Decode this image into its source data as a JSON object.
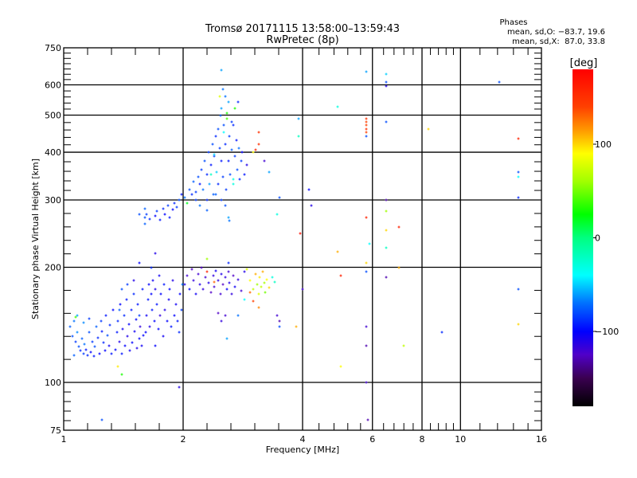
{
  "chart_data": {
    "type": "scatter",
    "title": "Tromsø 20171115 13:58:00–13:59:43",
    "subtitle": "RwPretec (8p)",
    "stats": {
      "heading": "Phases",
      "o_line": "mean, sd,O: −83.7, 19.6",
      "x_line": "mean, sd,X:  87.0, 33.8"
    },
    "xlabel": "Frequency [MHz]",
    "ylabel": "Stationary phase Virtual Height [km]",
    "xscale": "log",
    "yscale": "log",
    "xlim": [
      1,
      16
    ],
    "ylim": [
      75,
      750
    ],
    "xticks": [
      1,
      2,
      4,
      6,
      8,
      10,
      16
    ],
    "xtick_labels": [
      "1",
      "2",
      "4",
      "6",
      "8",
      "10",
      "16"
    ],
    "yticks": [
      75,
      100,
      200,
      300,
      400,
      500,
      600,
      750
    ],
    "ytick_labels": [
      "75",
      "100",
      "200",
      "300",
      "400",
      "500",
      "600",
      "750"
    ],
    "grid": true,
    "colorbar": {
      "label": "[deg]",
      "range": [
        -180,
        180
      ],
      "ticks": [
        100,
        0,
        -100
      ],
      "tick_labels": [
        "100",
        "0",
        "−100"
      ],
      "stops": [
        [
          -180,
          "#000000"
        ],
        [
          -150,
          "#3a0050"
        ],
        [
          -125,
          "#5000c8"
        ],
        [
          -100,
          "#0000ff"
        ],
        [
          -70,
          "#0070ff"
        ],
        [
          -40,
          "#00ffff"
        ],
        [
          0,
          "#00ff80"
        ],
        [
          25,
          "#00ff00"
        ],
        [
          60,
          "#a0ff00"
        ],
        [
          90,
          "#ffff00"
        ],
        [
          115,
          "#ff9900"
        ],
        [
          140,
          "#ff4000"
        ],
        [
          180,
          "#ff0000"
        ]
      ]
    },
    "point_fields": [
      "frequency_mhz",
      "height_km",
      "phase_deg"
    ],
    "points": [
      [
        1.04,
        140,
        -75
      ],
      [
        1.05,
        132,
        -80
      ],
      [
        1.06,
        145,
        -70
      ],
      [
        1.07,
        128,
        -85
      ],
      [
        1.08,
        135,
        -65
      ],
      [
        1.09,
        124,
        -80
      ],
      [
        1.1,
        121,
        -90
      ],
      [
        1.11,
        130,
        -75
      ],
      [
        1.12,
        119,
        -85
      ],
      [
        1.13,
        126,
        -70
      ],
      [
        1.14,
        122,
        -95
      ],
      [
        1.15,
        118,
        -90
      ],
      [
        1.16,
        135,
        -80
      ],
      [
        1.17,
        120,
        -100
      ],
      [
        1.18,
        128,
        -85
      ],
      [
        1.19,
        117,
        -95
      ],
      [
        1.2,
        124,
        -80
      ],
      [
        1.21,
        140,
        -75
      ],
      [
        1.22,
        131,
        -90
      ],
      [
        1.23,
        119,
        -100
      ],
      [
        1.24,
        145,
        -85
      ],
      [
        1.25,
        136,
        -95
      ],
      [
        1.26,
        127,
        -90
      ],
      [
        1.27,
        121,
        -100
      ],
      [
        1.28,
        150,
        -95
      ],
      [
        1.29,
        133,
        -80
      ],
      [
        1.3,
        125,
        -105
      ],
      [
        1.31,
        141,
        -90
      ],
      [
        1.32,
        119,
        -95
      ],
      [
        1.33,
        155,
        -100
      ],
      [
        1.08,
        150,
        -60
      ],
      [
        1.12,
        143,
        -65
      ],
      [
        1.06,
        118,
        -75
      ],
      [
        1.16,
        147,
        -85
      ],
      [
        1.37,
        110,
        95
      ],
      [
        1.07,
        148,
        40
      ],
      [
        1.35,
        122,
        -100
      ],
      [
        1.36,
        135,
        -95
      ],
      [
        1.37,
        145,
        -90
      ],
      [
        1.38,
        128,
        -110
      ],
      [
        1.39,
        160,
        -100
      ],
      [
        1.4,
        119,
        -95
      ],
      [
        1.41,
        138,
        -105
      ],
      [
        1.42,
        150,
        -90
      ],
      [
        1.43,
        125,
        -100
      ],
      [
        1.44,
        165,
        -95
      ],
      [
        1.45,
        132,
        -110
      ],
      [
        1.46,
        142,
        -100
      ],
      [
        1.47,
        121,
        -105
      ],
      [
        1.48,
        155,
        -95
      ],
      [
        1.49,
        127,
        -100
      ],
      [
        1.5,
        170,
        -90
      ],
      [
        1.51,
        136,
        -105
      ],
      [
        1.52,
        146,
        -100
      ],
      [
        1.53,
        123,
        -110
      ],
      [
        1.54,
        160,
        -95
      ],
      [
        1.55,
        130,
        -100
      ],
      [
        1.56,
        140,
        -115
      ],
      [
        1.57,
        125,
        -105
      ],
      [
        1.58,
        175,
        -95
      ],
      [
        1.59,
        133,
        -100
      ],
      [
        1.4,
        175,
        -80
      ],
      [
        1.45,
        180,
        -85
      ],
      [
        1.5,
        185,
        -110
      ],
      [
        1.38,
        155,
        -75
      ],
      [
        1.55,
        150,
        -85
      ],
      [
        1.61,
        135,
        -100
      ],
      [
        1.62,
        150,
        -105
      ],
      [
        1.63,
        165,
        -95
      ],
      [
        1.64,
        180,
        -100
      ],
      [
        1.65,
        140,
        -110
      ],
      [
        1.66,
        170,
        -100
      ],
      [
        1.67,
        155,
        -95
      ],
      [
        1.68,
        185,
        -105
      ],
      [
        1.69,
        145,
        -100
      ],
      [
        1.7,
        175,
        -110
      ],
      [
        1.72,
        160,
        -95
      ],
      [
        1.73,
        138,
        -100
      ],
      [
        1.74,
        190,
        -105
      ],
      [
        1.75,
        150,
        -115
      ],
      [
        1.76,
        170,
        -100
      ],
      [
        1.78,
        132,
        -105
      ],
      [
        1.79,
        180,
        -95
      ],
      [
        1.8,
        155,
        -110
      ],
      [
        1.82,
        145,
        -100
      ],
      [
        1.84,
        165,
        -105
      ],
      [
        1.85,
        175,
        -100
      ],
      [
        1.87,
        140,
        -95
      ],
      [
        1.88,
        185,
        -110
      ],
      [
        1.9,
        150,
        -100
      ],
      [
        1.92,
        160,
        -105
      ],
      [
        1.94,
        145,
        -95
      ],
      [
        1.96,
        170,
        -100
      ],
      [
        1.98,
        155,
        -85
      ],
      [
        1.99,
        180,
        -70
      ],
      [
        1.95,
        135,
        -90
      ],
      [
        1.7,
        125,
        -100
      ],
      [
        1.66,
        200,
        -90
      ],
      [
        2.02,
        180,
        -110
      ],
      [
        2.05,
        190,
        -120
      ],
      [
        2.08,
        175,
        -100
      ],
      [
        2.1,
        198,
        -125
      ],
      [
        2.12,
        185,
        -115
      ],
      [
        2.15,
        170,
        -105
      ],
      [
        2.18,
        192,
        -120
      ],
      [
        2.2,
        180,
        -110
      ],
      [
        2.22,
        200,
        -125
      ],
      [
        2.25,
        175,
        -115
      ],
      [
        2.28,
        188,
        -120
      ],
      [
        2.3,
        195,
        160
      ],
      [
        2.32,
        182,
        -110
      ],
      [
        2.35,
        172,
        -125
      ],
      [
        2.38,
        190,
        -115
      ],
      [
        2.4,
        178,
        -120
      ],
      [
        2.42,
        196,
        -105
      ],
      [
        2.45,
        185,
        -115
      ],
      [
        2.48,
        170,
        -120
      ],
      [
        2.5,
        192,
        -110
      ],
      [
        2.52,
        180,
        -125
      ],
      [
        2.55,
        188,
        -115
      ],
      [
        2.58,
        175,
        -100
      ],
      [
        2.6,
        195,
        -120
      ],
      [
        2.62,
        182,
        -110
      ],
      [
        2.65,
        170,
        -115
      ],
      [
        2.68,
        190,
        -125
      ],
      [
        2.7,
        178,
        -105
      ],
      [
        2.75,
        186,
        -115
      ],
      [
        2.8,
        174,
        -120
      ],
      [
        2.85,
        195,
        -110
      ],
      [
        2.55,
        150,
        -120
      ],
      [
        2.5,
        145,
        -115
      ],
      [
        2.45,
        152,
        -125
      ],
      [
        2.6,
        205,
        -90
      ],
      [
        2.3,
        210,
        60
      ],
      [
        2.4,
        183,
        130
      ],
      [
        2.9,
        198,
        80
      ],
      [
        2.95,
        185,
        90
      ],
      [
        3.0,
        175,
        70
      ],
      [
        3.05,
        192,
        110
      ],
      [
        3.08,
        180,
        60
      ],
      [
        3.1,
        170,
        80
      ],
      [
        3.12,
        188,
        95
      ],
      [
        3.15,
        178,
        70
      ],
      [
        3.18,
        195,
        110
      ],
      [
        3.2,
        182,
        60
      ],
      [
        3.22,
        172,
        50
      ],
      [
        3.25,
        186,
        90
      ],
      [
        3.3,
        177,
        100
      ],
      [
        3.0,
        163,
        140
      ],
      [
        2.95,
        172,
        130
      ],
      [
        3.1,
        157,
        120
      ],
      [
        3.35,
        188,
        -30
      ],
      [
        3.4,
        183,
        -20
      ],
      [
        3.45,
        150,
        -120
      ],
      [
        3.5,
        145,
        -130
      ],
      [
        2.85,
        165,
        -40
      ],
      [
        2.75,
        150,
        -70
      ],
      [
        1.6,
        270,
        -80
      ],
      [
        1.62,
        275,
        -85
      ],
      [
        1.65,
        268,
        -90
      ],
      [
        1.7,
        272,
        -100
      ],
      [
        1.72,
        280,
        -85
      ],
      [
        1.75,
        266,
        -95
      ],
      [
        1.78,
        285,
        -90
      ],
      [
        1.8,
        275,
        -100
      ],
      [
        1.83,
        290,
        -85
      ],
      [
        1.85,
        270,
        -95
      ],
      [
        1.88,
        283,
        -100
      ],
      [
        1.9,
        295,
        -90
      ],
      [
        1.93,
        288,
        -85
      ],
      [
        1.95,
        300,
        -80
      ],
      [
        1.98,
        310,
        -95
      ],
      [
        1.6,
        260,
        -75
      ],
      [
        1.55,
        205,
        -100
      ],
      [
        1.7,
        218,
        -110
      ],
      [
        1.55,
        275,
        -80
      ],
      [
        1.6,
        285,
        -75
      ],
      [
        2.02,
        305,
        -70
      ],
      [
        2.05,
        295,
        20
      ],
      [
        2.08,
        320,
        -80
      ],
      [
        2.1,
        310,
        -90
      ],
      [
        2.12,
        335,
        -75
      ],
      [
        2.15,
        315,
        -85
      ],
      [
        2.18,
        345,
        -80
      ],
      [
        2.2,
        330,
        -95
      ],
      [
        2.22,
        360,
        -85
      ],
      [
        2.25,
        320,
        -70
      ],
      [
        2.27,
        380,
        -80
      ],
      [
        2.3,
        350,
        -90
      ],
      [
        2.32,
        400,
        -85
      ],
      [
        2.33,
        330,
        -60
      ],
      [
        2.35,
        370,
        -95
      ],
      [
        2.37,
        420,
        -80
      ],
      [
        2.38,
        310,
        -75
      ],
      [
        2.4,
        390,
        -85
      ],
      [
        2.42,
        440,
        -90
      ],
      [
        2.43,
        355,
        -50
      ],
      [
        2.45,
        460,
        -80
      ],
      [
        2.45,
        330,
        -90
      ],
      [
        2.47,
        410,
        -85
      ],
      [
        2.48,
        500,
        -75
      ],
      [
        2.5,
        380,
        -95
      ],
      [
        2.5,
        520,
        -60
      ],
      [
        2.52,
        345,
        -85
      ],
      [
        2.53,
        470,
        -80
      ],
      [
        2.55,
        560,
        -70
      ],
      [
        2.55,
        420,
        -90
      ],
      [
        2.57,
        320,
        -85
      ],
      [
        2.58,
        490,
        40
      ],
      [
        2.6,
        380,
        -95
      ],
      [
        2.6,
        540,
        -60
      ],
      [
        2.62,
        440,
        -85
      ],
      [
        2.63,
        350,
        -80
      ],
      [
        2.65,
        405,
        -75
      ],
      [
        2.67,
        470,
        -90
      ],
      [
        2.68,
        330,
        -30
      ],
      [
        2.7,
        390,
        -85
      ],
      [
        2.72,
        430,
        -95
      ],
      [
        2.74,
        360,
        -80
      ],
      [
        2.76,
        410,
        -70
      ],
      [
        2.78,
        340,
        -90
      ],
      [
        2.8,
        380,
        -85
      ],
      [
        2.82,
        400,
        -100
      ],
      [
        2.85,
        350,
        -95
      ],
      [
        2.9,
        370,
        -110
      ],
      [
        2.47,
        560,
        80
      ],
      [
        2.52,
        585,
        -70
      ],
      [
        2.58,
        505,
        30
      ],
      [
        2.4,
        395,
        -50
      ],
      [
        2.35,
        350,
        -20
      ],
      [
        2.53,
        450,
        -40
      ],
      [
        2.67,
        340,
        -30
      ],
      [
        2.6,
        270,
        -60
      ],
      [
        2.62,
        265,
        -70
      ],
      [
        2.3,
        300,
        -90
      ],
      [
        2.42,
        310,
        -75
      ],
      [
        2.5,
        300,
        -85
      ],
      [
        2.55,
        290,
        -80
      ],
      [
        2.2,
        290,
        -70
      ],
      [
        2.15,
        300,
        -85
      ],
      [
        2.75,
        540,
        -90
      ],
      [
        2.7,
        520,
        30
      ],
      [
        2.65,
        480,
        -85
      ],
      [
        3.1,
        420,
        150
      ],
      [
        3.1,
        450,
        150
      ],
      [
        3.0,
        400,
        90
      ],
      [
        3.05,
        405,
        160
      ],
      [
        3.2,
        380,
        -120
      ],
      [
        3.3,
        355,
        -60
      ],
      [
        3.5,
        305,
        -80
      ],
      [
        3.45,
        275,
        -30
      ],
      [
        3.9,
        490,
        -60
      ],
      [
        3.9,
        440,
        -20
      ],
      [
        3.95,
        245,
        170
      ],
      [
        4.0,
        175,
        -120
      ],
      [
        4.15,
        320,
        -100
      ],
      [
        4.2,
        290,
        -110
      ],
      [
        3.85,
        140,
        110
      ],
      [
        3.5,
        140,
        -80
      ],
      [
        4.9,
        525,
        -30
      ],
      [
        4.9,
        220,
        110
      ],
      [
        5.0,
        190,
        160
      ],
      [
        5.0,
        110,
        90
      ],
      [
        5.8,
        650,
        -60
      ],
      [
        5.8,
        490,
        150
      ],
      [
        5.8,
        480,
        140
      ],
      [
        5.8,
        470,
        140
      ],
      [
        5.8,
        460,
        150
      ],
      [
        5.8,
        450,
        140
      ],
      [
        5.8,
        440,
        -80
      ],
      [
        5.8,
        270,
        160
      ],
      [
        5.8,
        205,
        100
      ],
      [
        5.8,
        195,
        -80
      ],
      [
        5.8,
        140,
        -120
      ],
      [
        5.8,
        125,
        -130
      ],
      [
        5.8,
        100,
        -120
      ],
      [
        5.85,
        80,
        -130
      ],
      [
        5.9,
        230,
        -40
      ],
      [
        6.5,
        640,
        -50
      ],
      [
        6.5,
        610,
        -80
      ],
      [
        6.5,
        595,
        -110
      ],
      [
        6.5,
        480,
        -80
      ],
      [
        6.5,
        300,
        -130
      ],
      [
        6.5,
        280,
        60
      ],
      [
        6.5,
        250,
        100
      ],
      [
        6.5,
        225,
        -20
      ],
      [
        6.5,
        188,
        -130
      ],
      [
        7.0,
        255,
        160
      ],
      [
        7.0,
        200,
        110
      ],
      [
        7.2,
        125,
        70
      ],
      [
        8.3,
        460,
        100
      ],
      [
        9.0,
        135,
        -90
      ],
      [
        12.5,
        610,
        -80
      ],
      [
        14.0,
        435,
        160
      ],
      [
        14.0,
        355,
        -80
      ],
      [
        14.0,
        345,
        -40
      ],
      [
        14.0,
        305,
        -90
      ],
      [
        14.0,
        175,
        -80
      ],
      [
        14.0,
        142,
        100
      ],
      [
        1.95,
        97,
        -110
      ],
      [
        1.25,
        80,
        -80
      ],
      [
        1.4,
        105,
        30
      ],
      [
        2.5,
        655,
        -60
      ],
      [
        2.58,
        130,
        -60
      ],
      [
        2.3,
        282,
        -75
      ]
    ]
  }
}
